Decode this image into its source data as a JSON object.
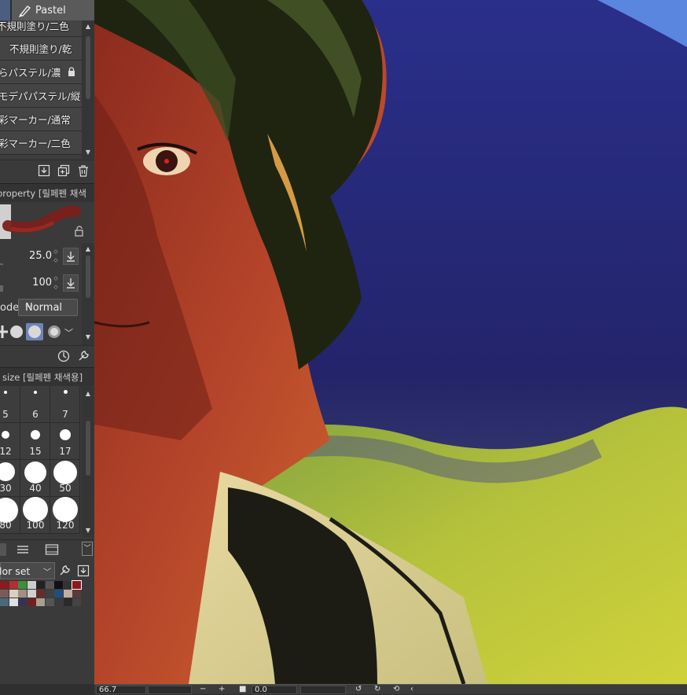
{
  "window": {
    "tab_label": "Pastel"
  },
  "brush_list": {
    "items": [
      {
        "label": "不規則塗り/二色"
      },
      {
        "label": "不規則塗り/乾"
      },
      {
        "label": "らパステル/濃"
      },
      {
        "label": "モデパパステル/縦"
      },
      {
        "label": "彩マーカー/通常"
      },
      {
        "label": "彩マーカー/二色"
      }
    ]
  },
  "tool_property": {
    "header": "property [릴페펜 채색",
    "brush_size": "25.0",
    "opacity": "100",
    "blend_label": "ode",
    "blend_mode": "Normal"
  },
  "brush_size_panel": {
    "header": "size [릴페펜 채색용]",
    "sizes": [
      "5",
      "6",
      "7",
      "12",
      "15",
      "17",
      "30",
      "40",
      "50",
      "80",
      "100",
      "120"
    ]
  },
  "color_set": {
    "label": "lor set",
    "swatches_row1": [
      "#8b1a1a",
      "#b03030",
      "#3d8f3d",
      "#cccccc",
      "#222222",
      "#555555",
      "#111111",
      "#333333",
      "#8b1a1a"
    ],
    "swatches_row2": [
      "#7a5b5b",
      "#d8d0c0",
      "#a09080",
      "#d0d0d0",
      "#6b2a2a",
      "#404040",
      "#1f4f7f",
      "#c0b0a0",
      "#5a3a3a"
    ],
    "swatches_row3": [
      "#4a6a7a",
      "#e0e0e0",
      "#333355",
      "#702020",
      "#a8a090",
      "#555555",
      "#3a3a3a",
      "#2a2a2a",
      "#444444"
    ]
  },
  "status_bar": {
    "zoom": "66.7",
    "rotation": "0.0"
  },
  "colors": {
    "panel_bg": "#3a3a3a",
    "accent": "#4b5d80",
    "sky": "#2a2a7a",
    "grass": "#b8c23a",
    "skin": "#b0452a"
  }
}
